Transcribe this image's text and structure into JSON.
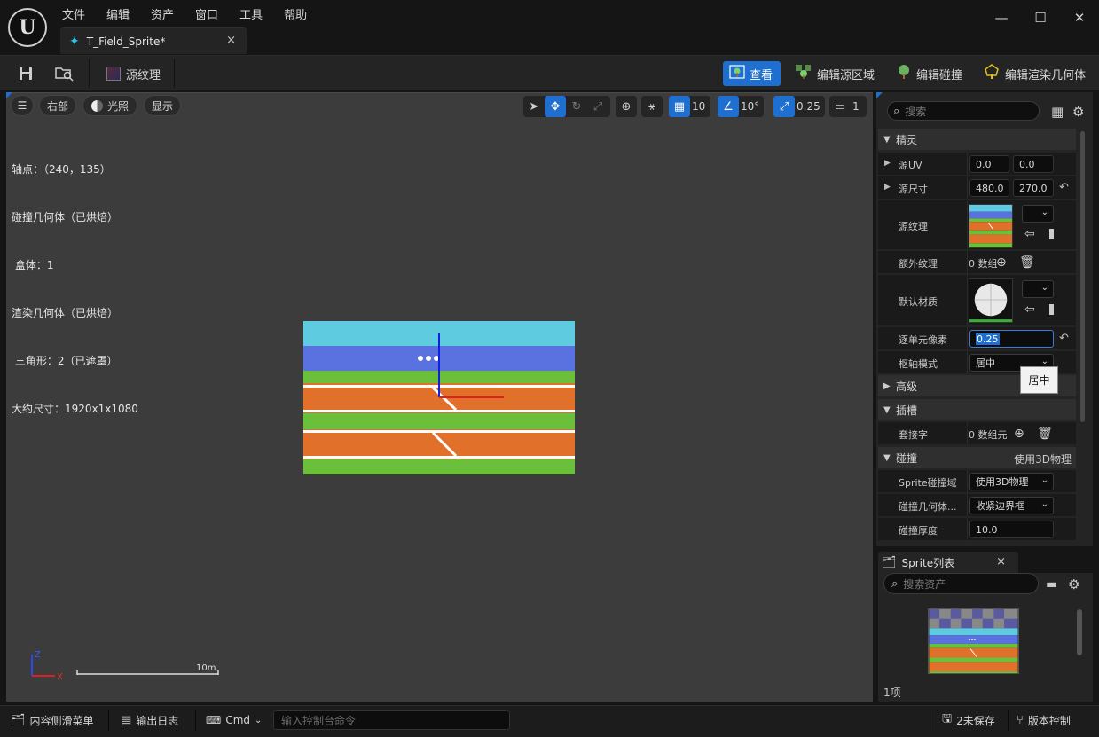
{
  "app": {
    "logo_text": "U",
    "menu": [
      "文件",
      "编辑",
      "资产",
      "窗口",
      "工具",
      "帮助"
    ],
    "doc_tab": {
      "label": "T_Field_Sprite*",
      "close": "×"
    },
    "win_controls": {
      "minimize": "—",
      "maximize": "☐",
      "close": "✕"
    }
  },
  "toolbar": {
    "source_texture_label": "源纹理",
    "view_label": "查看",
    "edit_source_region_label": "编辑源区域",
    "edit_collision_label": "编辑碰撞",
    "edit_render_geometry_label": "编辑渲染几何体",
    "accent_color": "#1f6fd0"
  },
  "viewport": {
    "view_mode_label": "右部",
    "lighting_label": "光照",
    "show_label": "显示",
    "grid_snap_value": "10",
    "rotation_snap_value": "10°",
    "scale_snap_value": "0.25",
    "camera_speed_value": "1",
    "stats": {
      "pivot": "轴点：（240，135）",
      "collision_baked": "碰撞几何体（已烘焙）",
      "box_count": " 盒体：1",
      "render_baked": "渲染几何体（已烘焙）",
      "triangles": " 三角形：2（已遮罩）",
      "approx_size": "大约尺寸：1920x1x1080"
    },
    "scale_bar_label": "10m",
    "axis_z": "Z",
    "axis_x": "X"
  },
  "details": {
    "search_placeholder": "搜索",
    "categories": {
      "sprite": "精灵",
      "advanced": "高级",
      "sockets": "插槽",
      "collision": "碰撞",
      "collision_value": "使用3D物理"
    },
    "props": {
      "source_uv": {
        "label": "源UV",
        "x": "0.0",
        "y": "0.0"
      },
      "source_dimension": {
        "label": "源尺寸",
        "x": "480.0",
        "y": "270.0"
      },
      "source_texture": {
        "label": "源纹理"
      },
      "additional_textures": {
        "label": "额外纹理",
        "value": "0 数组"
      },
      "default_material": {
        "label": "默认材质"
      },
      "pixels_per_unit": {
        "label": "逐单元像素",
        "value": "0.25"
      },
      "pivot_mode": {
        "label": "枢轴模式",
        "value": "居中"
      },
      "socket_names": {
        "label": "套接字",
        "value": "0 数组元"
      },
      "sprite_collision_domain": {
        "label": "Sprite碰撞域",
        "value": "使用3D物理"
      },
      "collision_geometry": {
        "label": "碰撞几何体...",
        "value": "收紧边界框"
      },
      "collision_thickness": {
        "label": "碰撞厚度",
        "value": "10.0"
      }
    },
    "tooltip": "居中"
  },
  "sprite_list": {
    "tab_label": "Sprite列表",
    "tab_close": "×",
    "search_placeholder": "搜索资产",
    "item_count": "1项"
  },
  "statusbar": {
    "content_drawer": "内容侧滑菜单",
    "output_log": "输出日志",
    "cmd_label": "Cmd",
    "console_placeholder": "输入控制台命令",
    "unsaved": "2未保存",
    "source_control": "版本控制"
  },
  "colors": {
    "sky": "#5ecbe0",
    "blue_band": "#5a72e0",
    "grass": "#6cbf3a",
    "track": "#e0702a"
  }
}
